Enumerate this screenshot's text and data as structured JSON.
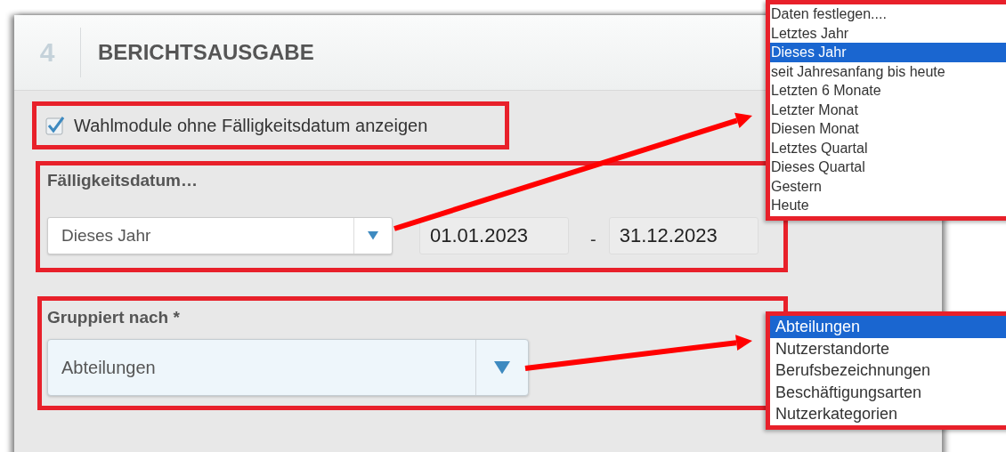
{
  "section": {
    "number": "4",
    "title": "BERICHTSAUSGABE"
  },
  "show_without_due_date": {
    "label": "Wahlmodule ohne Fälligkeitsdatum anzeigen",
    "checked": true
  },
  "due_date": {
    "label": "Fälligkeitsdatum…",
    "period": "Dieses Jahr",
    "start": "01.01.2023",
    "separator": "-",
    "end": "31.12.2023"
  },
  "grouped_by": {
    "label": "Gruppiert nach *",
    "value": "Abteilungen"
  },
  "period_options": [
    {
      "label": "Daten festlegen....",
      "selected": false
    },
    {
      "label": "Letztes Jahr",
      "selected": false
    },
    {
      "label": "Dieses Jahr",
      "selected": true
    },
    {
      "label": "seit Jahresanfang bis heute",
      "selected": false
    },
    {
      "label": "Letzten 6 Monate",
      "selected": false
    },
    {
      "label": "Letzter Monat",
      "selected": false
    },
    {
      "label": "Diesen Monat",
      "selected": false
    },
    {
      "label": "Letztes Quartal",
      "selected": false
    },
    {
      "label": "Dieses Quartal",
      "selected": false
    },
    {
      "label": "Gestern",
      "selected": false
    },
    {
      "label": "Heute",
      "selected": false
    }
  ],
  "group_options": [
    {
      "label": "Abteilungen",
      "selected": true
    },
    {
      "label": "Nutzerstandorte",
      "selected": false
    },
    {
      "label": "Berufsbezeichnungen",
      "selected": false
    },
    {
      "label": "Beschäftigungsarten",
      "selected": false
    },
    {
      "label": "Nutzerkategorien",
      "selected": false
    }
  ]
}
